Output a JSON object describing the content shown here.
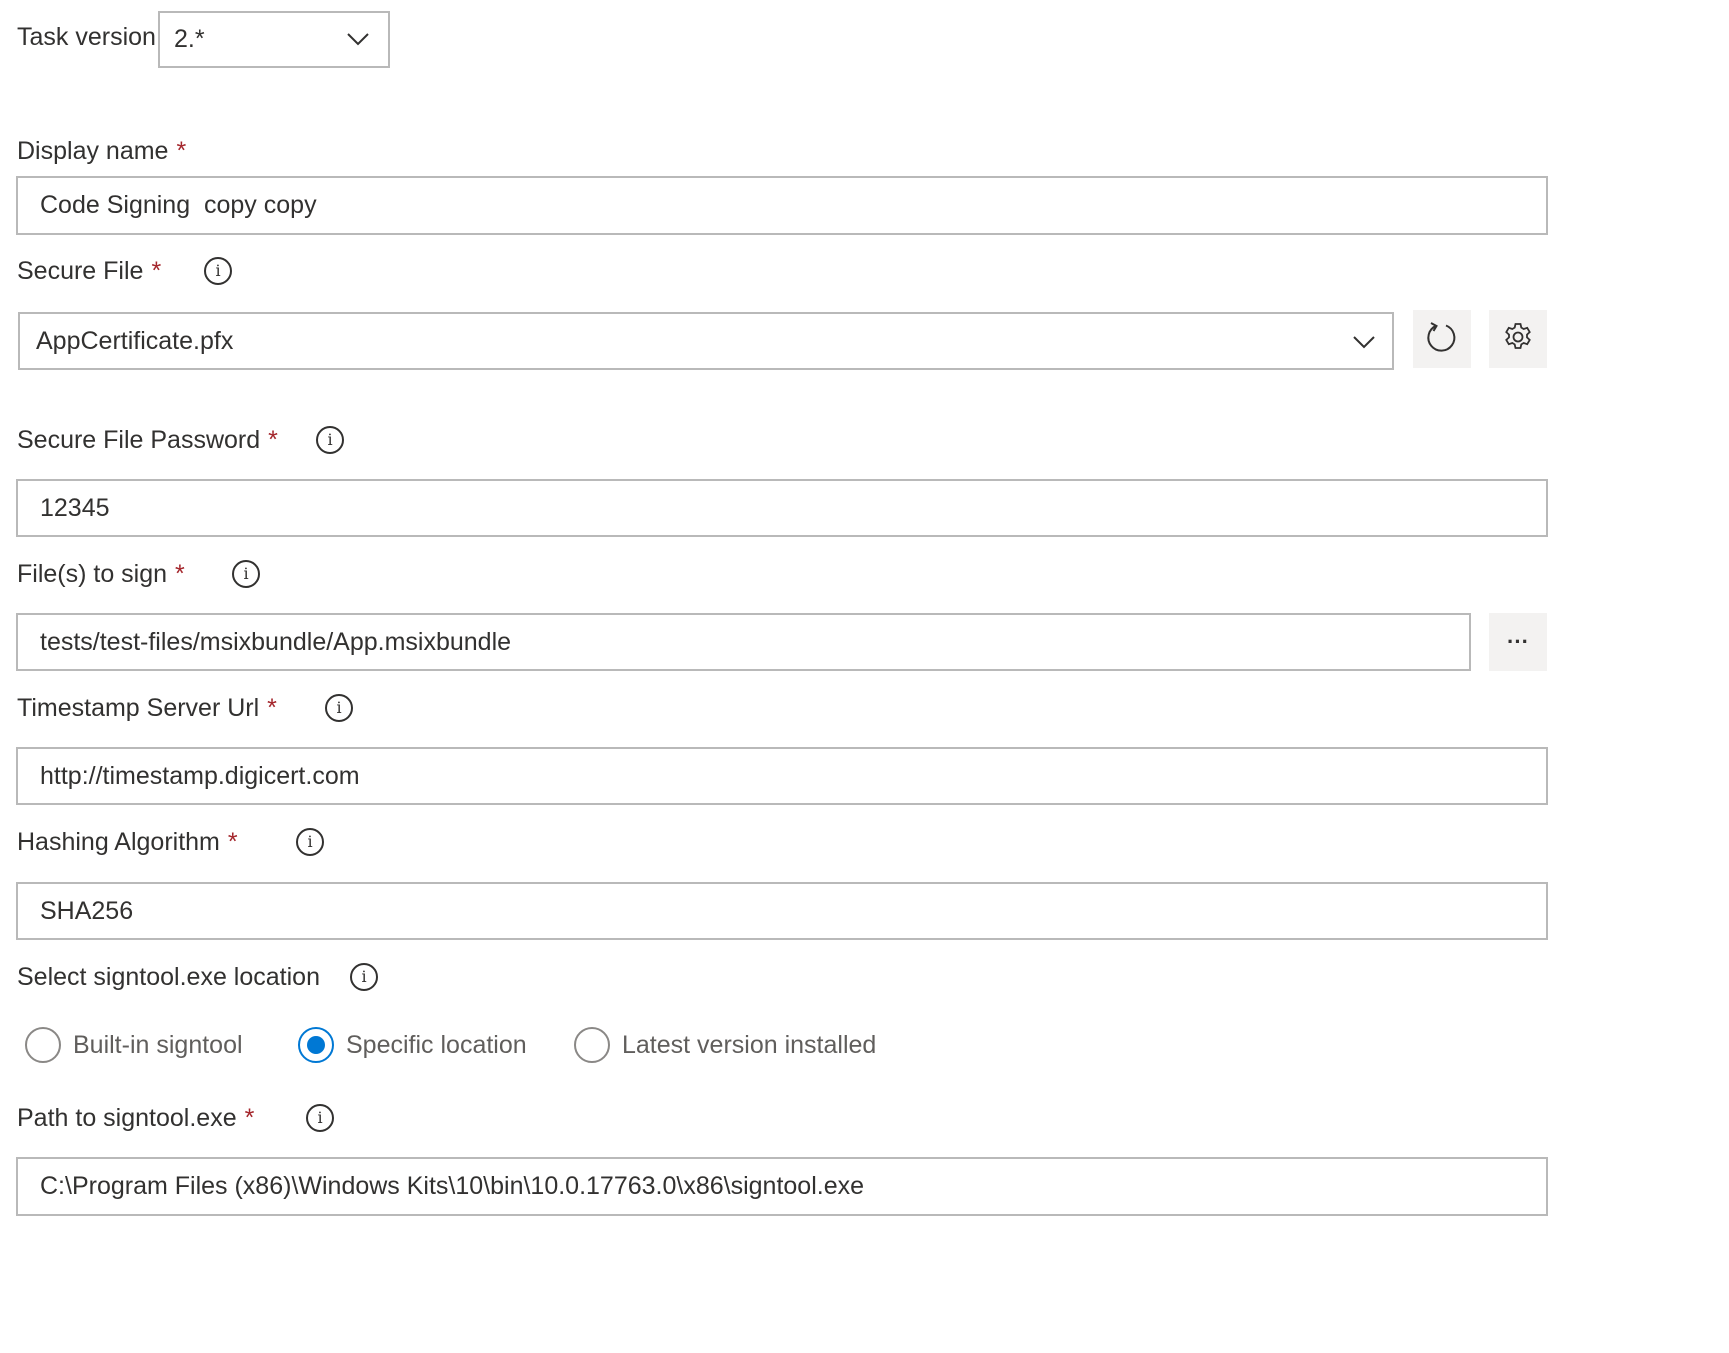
{
  "task_version": {
    "label": "Task version",
    "value": "2.*"
  },
  "display_name": {
    "label": "Display name",
    "required": "*",
    "value": "Code Signing  copy copy"
  },
  "secure_file": {
    "label": "Secure File",
    "required": "*",
    "value": "AppCertificate.pfx"
  },
  "secure_file_password": {
    "label": "Secure File Password",
    "required": "*",
    "value": "12345"
  },
  "files_to_sign": {
    "label": "File(s) to sign",
    "required": "*",
    "value": "tests/test-files/msixbundle/App.msixbundle",
    "browse_label": "···"
  },
  "timestamp_server": {
    "label": "Timestamp Server Url",
    "required": "*",
    "value": "http://timestamp.digicert.com"
  },
  "hashing_algorithm": {
    "label": "Hashing Algorithm",
    "required": "*",
    "value": "SHA256"
  },
  "signtool_location": {
    "label": "Select signtool.exe location",
    "options": [
      {
        "label": "Built-in signtool",
        "checked": false
      },
      {
        "label": "Specific location",
        "checked": true
      },
      {
        "label": "Latest version installed",
        "checked": false
      }
    ]
  },
  "signtool_path": {
    "label": "Path to signtool.exe",
    "required": "*",
    "value": "C:\\Program Files (x86)\\Windows Kits\\10\\bin\\10.0.17763.0\\x86\\signtool.exe"
  },
  "info_glyph": "i",
  "colors": {
    "accent": "#0078d4",
    "required": "#a4262c",
    "border": "#b9b9b9",
    "button_bg": "#f3f2f1"
  },
  "icons": [
    "chevron-down-icon",
    "refresh-icon",
    "gear-icon",
    "info-icon",
    "more-icon"
  ]
}
